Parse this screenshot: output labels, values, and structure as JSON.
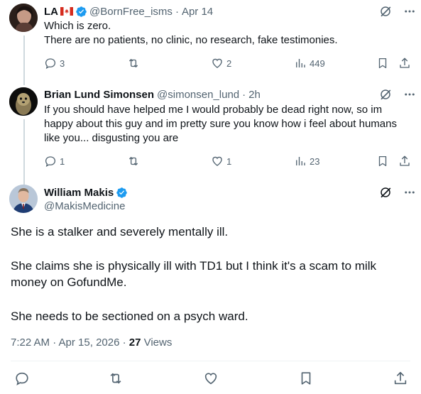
{
  "colors": {
    "accent": "#1d9bf0",
    "muted": "#536471",
    "text": "#0f1419"
  },
  "replies": [
    {
      "display_name": "LA",
      "flag": "canada-flag",
      "handle": "@BornFree_isms",
      "date": "Apr 14",
      "text_lines": [
        "Which is zero.",
        "There are no patients, no clinic, no research, fake testimonies."
      ],
      "stats": {
        "replies": "3",
        "reposts": "",
        "likes": "2",
        "views": "449"
      }
    },
    {
      "display_name": "Brian Lund Simonsen",
      "handle": "@simonsen_lund",
      "date": "2h",
      "text_lines": [
        "If you should have helped me I would probably be dead right now, so im",
        "happy about this guy and im pretty sure you know how i feel about humans",
        "like you... disgusting you are"
      ],
      "stats": {
        "replies": "1",
        "reposts": "",
        "likes": "1",
        "views": "23"
      }
    }
  ],
  "main_post": {
    "display_name": "William Makis",
    "handle": "@MakisMedicine",
    "paragraphs": [
      "She is a stalker and severely mentally ill.",
      "She claims she is physically ill with TD1 but I think it's a scam to milk",
      "money on GofundMe.",
      "She needs to be sectioned on a psych ward."
    ],
    "time": "7:22 AM · Apr 15, 2026 · ",
    "views_count": "27",
    "views_label": " Views"
  }
}
